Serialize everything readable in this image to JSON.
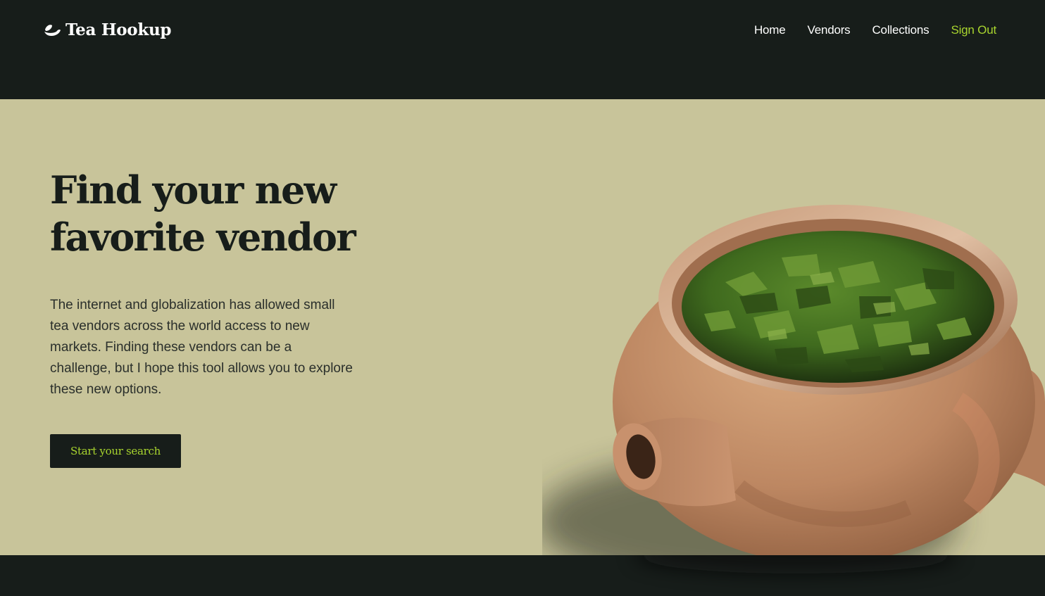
{
  "header": {
    "brand": "Tea Hookup",
    "brand_icon": "tea-leaf-icon",
    "nav": [
      {
        "label": "Home"
      },
      {
        "label": "Vendors"
      },
      {
        "label": "Collections"
      },
      {
        "label": "Sign Out"
      }
    ]
  },
  "hero": {
    "title_line1": "Find your new",
    "title_line2": "favorite vendor",
    "description": "The internet and globalization has allowed small tea vendors across the world access to new markets. Finding these vendors can be a challenge, but I hope this tool allows you to explore these new options.",
    "cta_label": "Start your search",
    "image": "clay-teapot-with-green-tea-leaves"
  },
  "colors": {
    "dark": "#171d1a",
    "hero_bg": "#c8c49a",
    "accent": "#a8d42e",
    "clay": "#c08d69"
  }
}
